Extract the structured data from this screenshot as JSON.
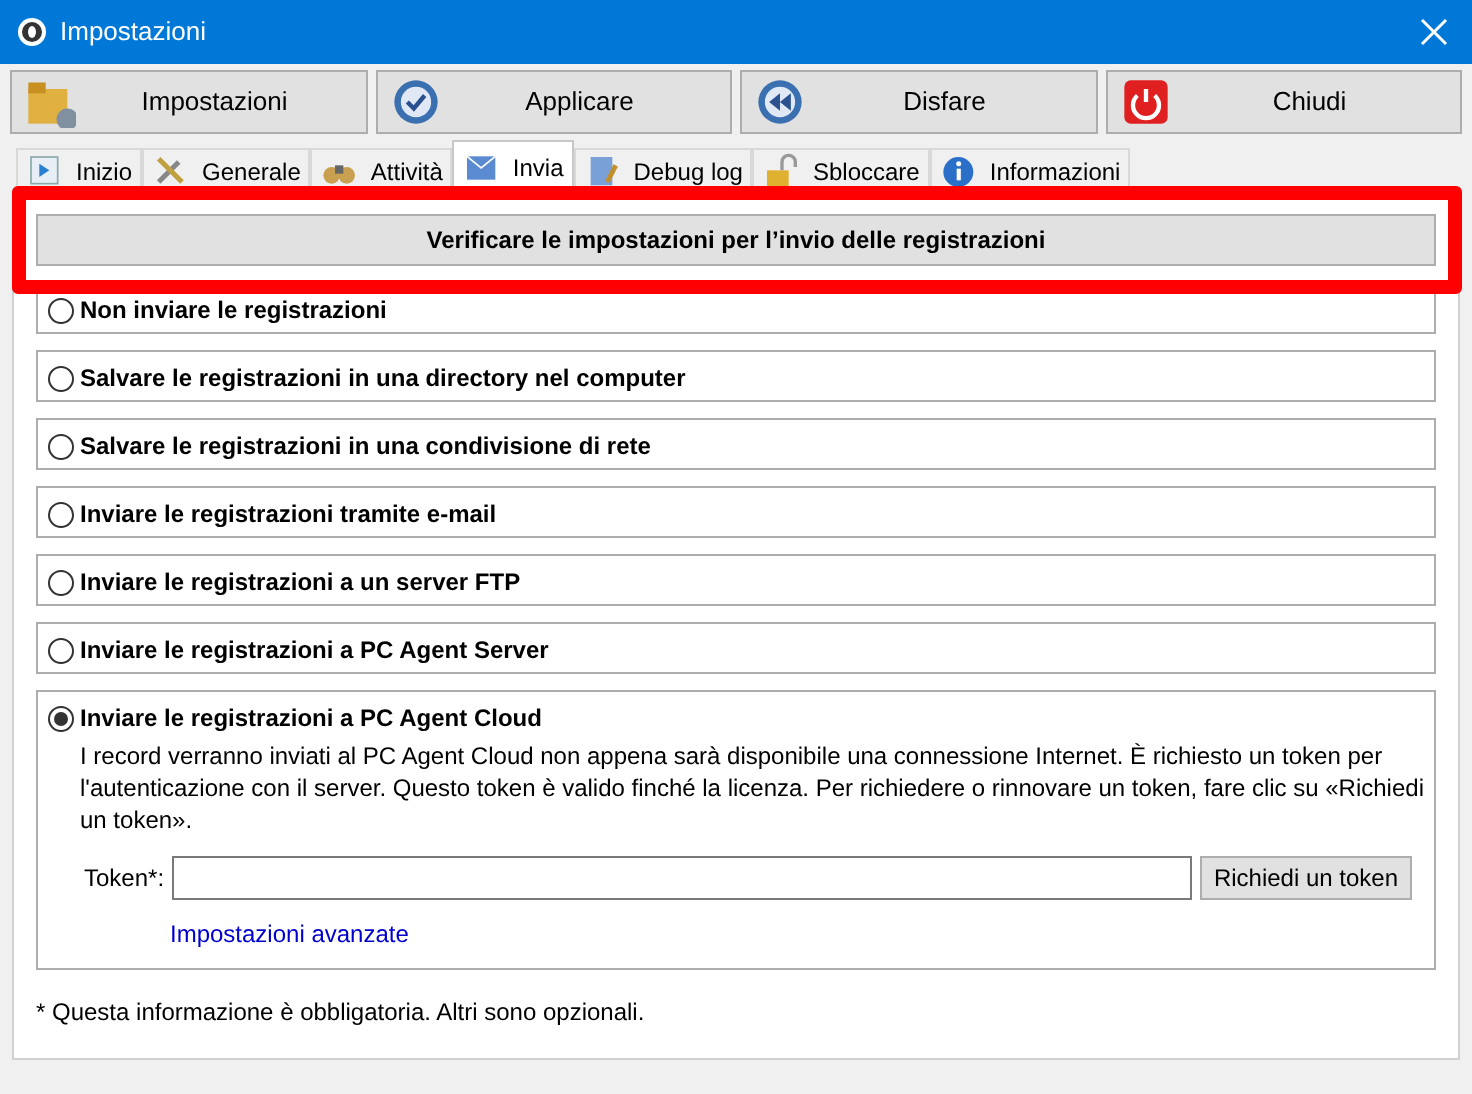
{
  "window": {
    "title": "Impostazioni"
  },
  "toolbar": [
    {
      "label": "Impostazioni"
    },
    {
      "label": "Applicare"
    },
    {
      "label": "Disfare"
    },
    {
      "label": "Chiudi"
    }
  ],
  "tabs": [
    {
      "label": "Inizio",
      "selected": false
    },
    {
      "label": "Generale",
      "selected": false
    },
    {
      "label": "Attività",
      "selected": false
    },
    {
      "label": "Invia",
      "selected": true
    },
    {
      "label": "Debug log",
      "selected": false
    },
    {
      "label": "Sbloccare",
      "selected": false
    },
    {
      "label": "Informazioni",
      "selected": false
    }
  ],
  "verify_button": "Verificare le impostazioni per l’invio delle registrazioni",
  "options": [
    {
      "label": "Non inviare le registrazioni",
      "selected": false
    },
    {
      "label": "Salvare le registrazioni in una directory nel computer",
      "selected": false
    },
    {
      "label": "Salvare le registrazioni in una condivisione di rete",
      "selected": false
    },
    {
      "label": "Inviare le registrazioni tramite e-mail",
      "selected": false
    },
    {
      "label": "Inviare le registrazioni a un server FTP",
      "selected": false
    },
    {
      "label": "Inviare le registrazioni a PC Agent Server",
      "selected": false
    },
    {
      "label": "Inviare le registrazioni a PC Agent Cloud",
      "selected": true,
      "description": "I record verranno inviati al PC Agent Cloud non appena sarà disponibile una connessione Internet. È richiesto un token per l'autenticazione con il server. Questo token è valido finché la licenza. Per richiedere o rinnovare un token, fare clic su «Richiedi un token».",
      "token_label": "Token*:",
      "token_button": "Richiedi un token",
      "advanced_link": "Impostazioni avanzate"
    }
  ],
  "footnote": "* Questa informazione è obbligatoria. Altri sono opzionali."
}
